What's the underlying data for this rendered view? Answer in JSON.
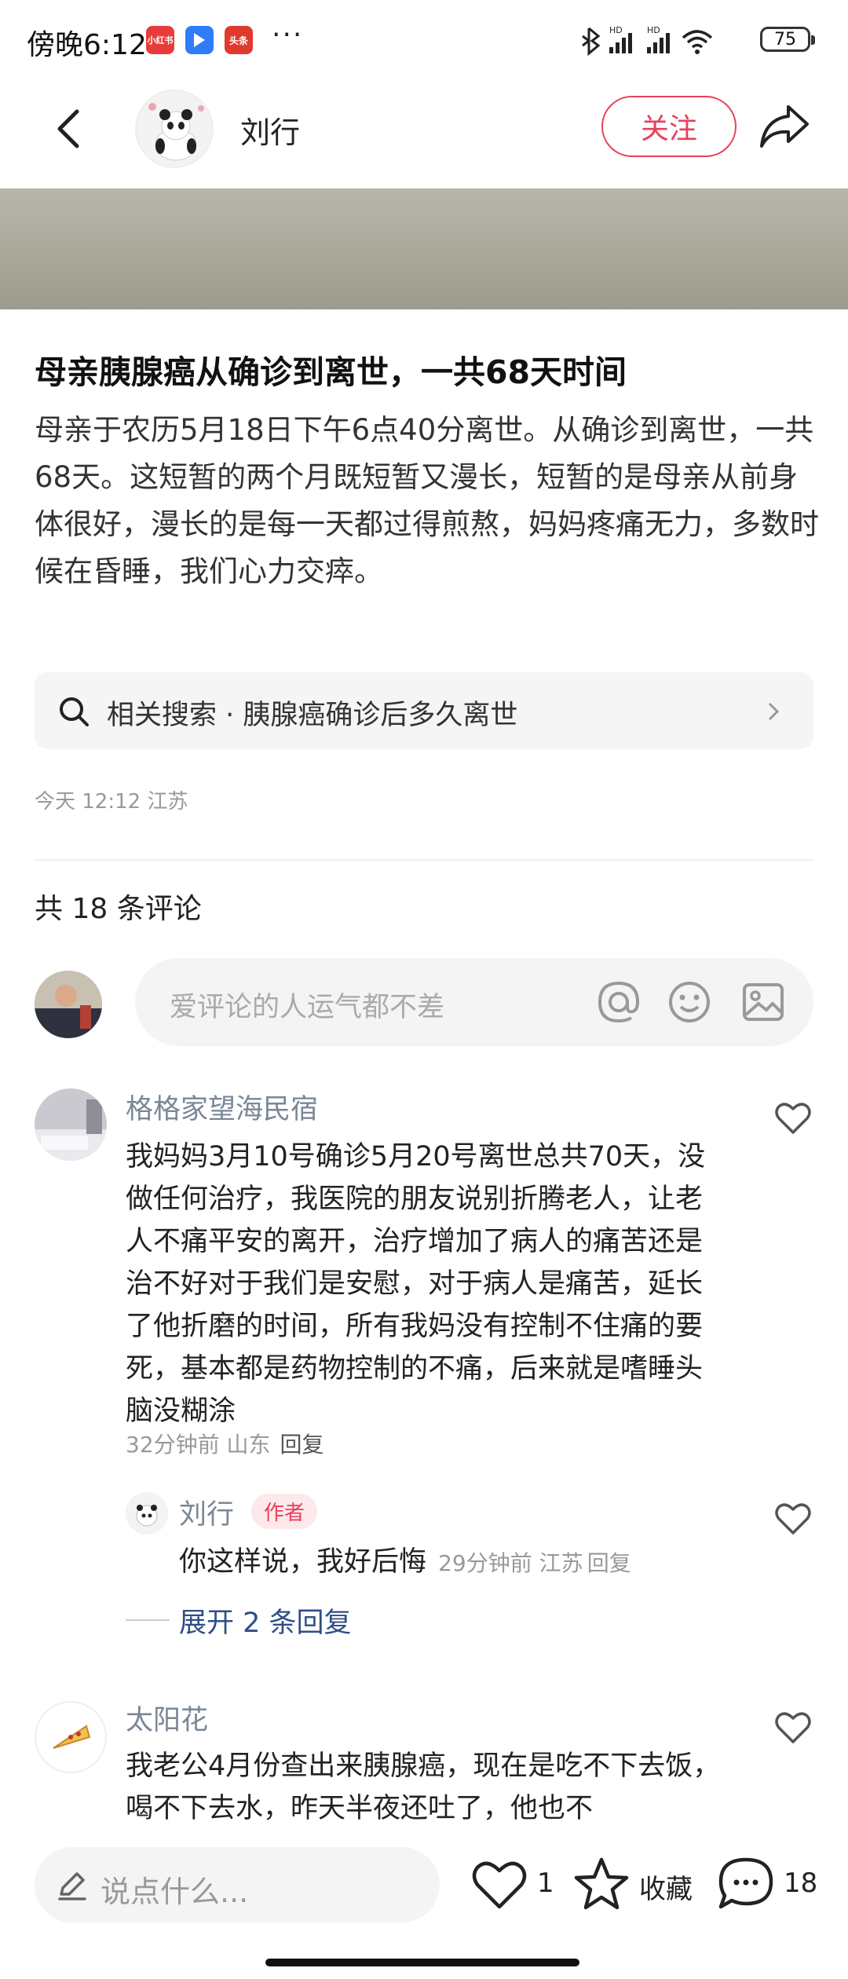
{
  "status_bar": {
    "time": "傍晚6:12",
    "app_icons": [
      {
        "name": "xiaohongshu-icon",
        "label": "小红书",
        "color": "#e83b3b"
      },
      {
        "name": "blue-app-icon",
        "label": "",
        "color": "#2f7cf6"
      },
      {
        "name": "toutiao-icon",
        "label": "头条",
        "color": "#e03a2f"
      }
    ],
    "more": "···",
    "battery": "75"
  },
  "header": {
    "author_name": "刘行",
    "follow_label": "关注"
  },
  "article": {
    "title": "母亲胰腺癌从确诊到离世，一共68天时间",
    "body": "母亲于农历5月18日下午6点40分离世。从确诊到离世，一共68天。这短暂的两个月既短暂又漫长，短暂的是母亲从前身体很好，漫长的是每一天都过得煎熬，妈妈疼痛无力，多数时候在昏睡，我们心力交瘁。",
    "related_search": "相关搜索 · 胰腺癌确诊后多久离世",
    "meta": "今天 12:12 江苏"
  },
  "comments_section": {
    "count_label": "共 18 条评论",
    "input_placeholder": "爱评论的人运气都不差"
  },
  "comments": [
    {
      "name": "格格家望海民宿",
      "text": "我妈妈3月10号确诊5月20号离世总共70天，没做任何治疗，我医院的朋友说别折腾老人，让老人不痛平安的离开，治疗增加了病人的痛苦还是治不好对于我们是安慰，对于病人是痛苦，延长了他折磨的时间，所有我妈没有控制不住痛的要死，基本都是药物控制的不痛，后来就是嗜睡头脑没糊涂",
      "time_loc": "32分钟前 山东",
      "reply_label": "回复",
      "sub_reply": {
        "name": "刘行",
        "tag": "作者",
        "text": "你这样说，我好后悔",
        "time_loc": "29分钟前 江苏",
        "reply_label": "回复"
      },
      "expand_label": "展开 2 条回复"
    },
    {
      "name": "太阳花",
      "text": "我老公4月份查出来胰腺癌，现在是吃不下去饭，喝不下去水，昨天半夜还吐了，他也不"
    }
  ],
  "bottom_bar": {
    "say_placeholder": "说点什么...",
    "like_count": "1",
    "collect_label": "收藏",
    "comment_count": "18"
  },
  "colors": {
    "accent": "#e8405c",
    "link": "#2f4e88",
    "username": "#7a8796"
  }
}
